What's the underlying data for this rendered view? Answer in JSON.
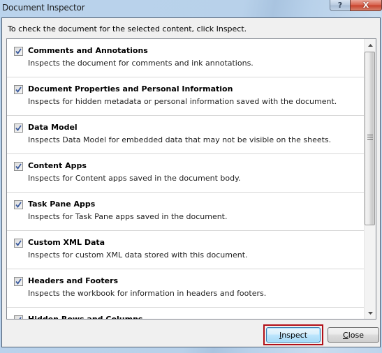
{
  "window": {
    "title": "Document Inspector",
    "help_label": "?",
    "close_label": "X"
  },
  "instruction": "To check the document for the selected content, click Inspect.",
  "items": [
    {
      "name": "Comments and Annotations",
      "description": "Inspects the document for comments and ink annotations.",
      "checked": true
    },
    {
      "name": "Document Properties and Personal Information",
      "description": "Inspects for hidden metadata or personal information saved with the document.",
      "checked": true
    },
    {
      "name": "Data Model",
      "description": "Inspects Data Model for embedded data that may not be visible on the sheets.",
      "checked": true
    },
    {
      "name": "Content Apps",
      "description": "Inspects for Content apps saved in the document body.",
      "checked": true
    },
    {
      "name": "Task Pane Apps",
      "description": "Inspects for Task Pane apps saved in the document.",
      "checked": true
    },
    {
      "name": "Custom XML Data",
      "description": "Inspects for custom XML data stored with this document.",
      "checked": true
    },
    {
      "name": "Headers and Footers",
      "description": "Inspects the workbook for information in headers and footers.",
      "checked": true
    },
    {
      "name": "Hidden Rows and Columns",
      "description": "",
      "checked": true
    }
  ],
  "scroll": {
    "position_fraction": 0.0
  },
  "buttons": {
    "inspect": {
      "label_prefix": "",
      "mnemonic": "I",
      "label_rest": "nspect"
    },
    "close": {
      "label_prefix": "",
      "mnemonic": "C",
      "label_rest": "lose"
    }
  },
  "colors": {
    "focus_ring": "#b10f17",
    "titlebar": "#b9d1ea",
    "checkmark": "#3b5b9e"
  }
}
